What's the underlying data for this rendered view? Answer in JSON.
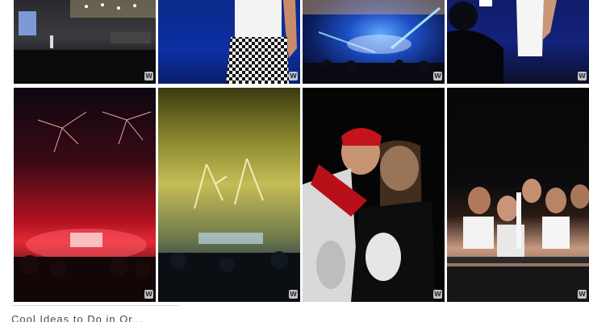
{
  "gallery": {
    "tiles": [
      {
        "scene": "stage-wide-shot",
        "watermark": "W"
      },
      {
        "scene": "performer-checkered-pants",
        "watermark": "W"
      },
      {
        "scene": "stage-blue-lights",
        "watermark": "W"
      },
      {
        "scene": "performer-white-top",
        "watermark": "W"
      },
      {
        "scene": "red-fireworks-stage",
        "watermark": "W"
      },
      {
        "scene": "yellow-fireworks-stage",
        "watermark": "W"
      },
      {
        "scene": "two-fans-selfie",
        "watermark": "W"
      },
      {
        "scene": "group-of-fans",
        "watermark": "W"
      }
    ]
  },
  "footer": {
    "caption": "Cool Ideas to Do in Or..."
  }
}
